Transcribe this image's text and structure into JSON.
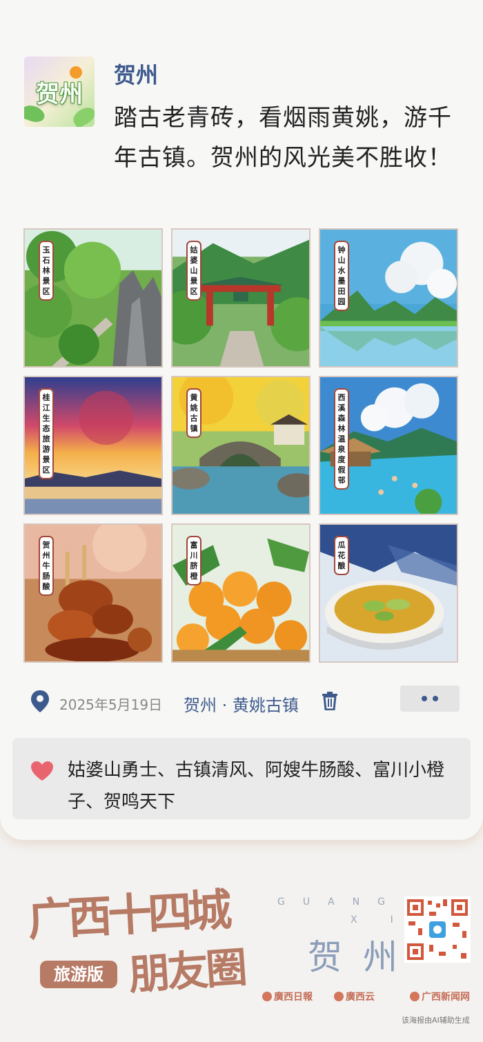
{
  "post": {
    "avatar_text": "贺州",
    "username": "贺州",
    "text": "踏古老青砖，看烟雨黄姚，游千年古镇。贺州的风光美不胜收！"
  },
  "tiles": [
    {
      "label": "玉石林景区",
      "icon": "karst-stone-forest"
    },
    {
      "label": "姑婆山景区",
      "icon": "mountain-gate"
    },
    {
      "label": "钟山水墨田园",
      "icon": "lake-mountains"
    },
    {
      "label": "桂江生态旅游景区",
      "icon": "sunset-river"
    },
    {
      "label": "黄姚古镇",
      "icon": "stone-bridge"
    },
    {
      "label": "西溪森林温泉度假邨",
      "icon": "hot-spring"
    },
    {
      "label": "贺州牛肠酸",
      "icon": "skewers"
    },
    {
      "label": "富川脐橙",
      "icon": "oranges"
    },
    {
      "label": "瓜花酿",
      "icon": "soup-bowl"
    }
  ],
  "meta": {
    "date": "2025年5月19日",
    "location": "贺州 · 黄姚古镇",
    "pin_icon": "location-pin-icon",
    "delete_icon": "trash-icon"
  },
  "likes": {
    "icon": "heart-icon",
    "text": "姑婆山勇士、古镇清风、阿嫂牛肠酸、富川小橙子、贺鸣天下"
  },
  "footer": {
    "brand_line1": "广西十四城",
    "brand_line2": "朋友圈",
    "edition": "旅游版",
    "guang": "GUANG",
    "xi": "XI",
    "city": "贺州",
    "logos": [
      "廣西日報",
      "廣西云",
      "广西新闻网"
    ],
    "ai_note": "该海报由AI辅助生成"
  },
  "colors": {
    "accent_blue": "#3d5a8c",
    "brand_terracotta": "#b67a65",
    "heart_red": "#e8646e"
  }
}
